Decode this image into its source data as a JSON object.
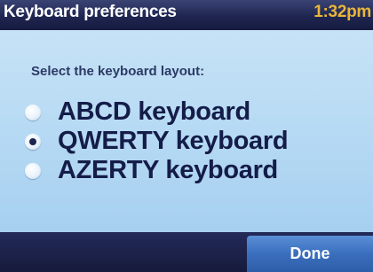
{
  "header": {
    "title": "Keyboard preferences",
    "time": "1:32pm"
  },
  "main": {
    "prompt": "Select the keyboard layout:",
    "options": [
      {
        "label": "ABCD keyboard",
        "selected": false
      },
      {
        "label": "QWERTY keyboard",
        "selected": true
      },
      {
        "label": "AZERTY keyboard",
        "selected": false
      }
    ]
  },
  "footer": {
    "done_label": "Done"
  },
  "colors": {
    "title_bar": "#1e2550",
    "time_text": "#e8b63a",
    "content_bg": "#b8dbf4",
    "option_text": "#141c48",
    "done_button": "#3a6fbe"
  }
}
